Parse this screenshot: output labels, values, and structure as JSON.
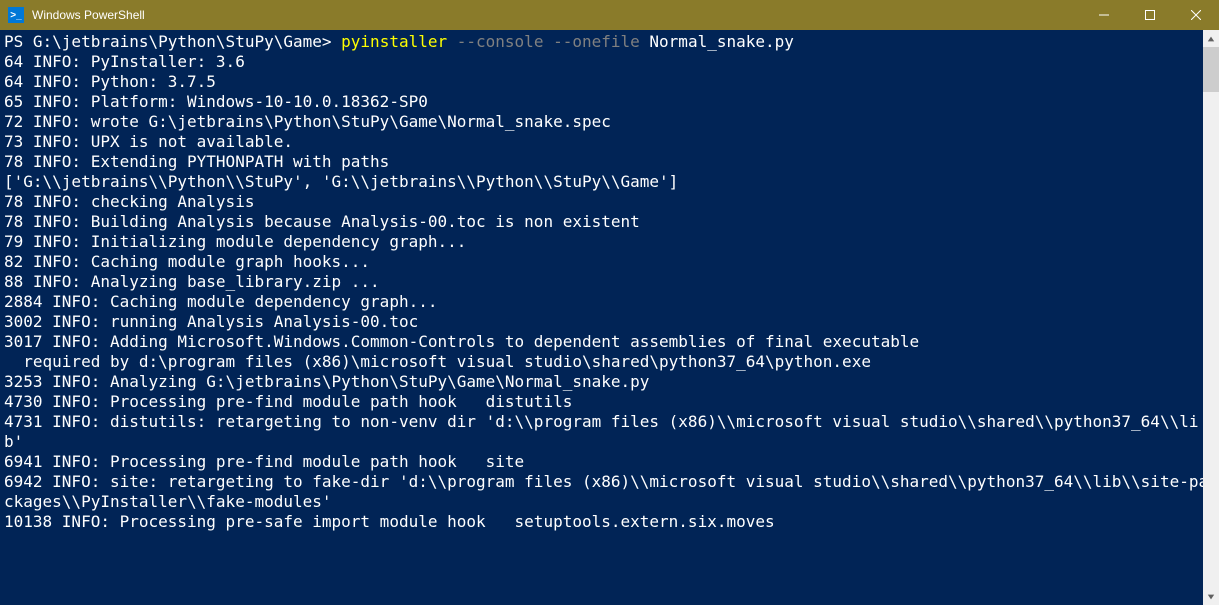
{
  "window": {
    "title": "Windows PowerShell"
  },
  "prompt": {
    "ps_path": "PS G:\\jetbrains\\Python\\StuPy\\Game> ",
    "cmd_name": "pyinstaller ",
    "cmd_flags": "--console --onefile ",
    "cmd_arg": "Normal_snake.py"
  },
  "lines": [
    "64 INFO: PyInstaller: 3.6",
    "64 INFO: Python: 3.7.5",
    "65 INFO: Platform: Windows-10-10.0.18362-SP0",
    "72 INFO: wrote G:\\jetbrains\\Python\\StuPy\\Game\\Normal_snake.spec",
    "73 INFO: UPX is not available.",
    "78 INFO: Extending PYTHONPATH with paths",
    "['G:\\\\jetbrains\\\\Python\\\\StuPy', 'G:\\\\jetbrains\\\\Python\\\\StuPy\\\\Game']",
    "78 INFO: checking Analysis",
    "78 INFO: Building Analysis because Analysis-00.toc is non existent",
    "79 INFO: Initializing module dependency graph...",
    "82 INFO: Caching module graph hooks...",
    "88 INFO: Analyzing base_library.zip ...",
    "2884 INFO: Caching module dependency graph...",
    "3002 INFO: running Analysis Analysis-00.toc",
    "3017 INFO: Adding Microsoft.Windows.Common-Controls to dependent assemblies of final executable",
    "  required by d:\\program files (x86)\\microsoft visual studio\\shared\\python37_64\\python.exe",
    "3253 INFO: Analyzing G:\\jetbrains\\Python\\StuPy\\Game\\Normal_snake.py",
    "4730 INFO: Processing pre-find module path hook   distutils",
    "4731 INFO: distutils: retargeting to non-venv dir 'd:\\\\program files (x86)\\\\microsoft visual studio\\\\shared\\\\python37_64\\\\lib'",
    "6941 INFO: Processing pre-find module path hook   site",
    "6942 INFO: site: retargeting to fake-dir 'd:\\\\program files (x86)\\\\microsoft visual studio\\\\shared\\\\python37_64\\\\lib\\\\site-packages\\\\PyInstaller\\\\fake-modules'",
    "10138 INFO: Processing pre-safe import module hook   setuptools.extern.six.moves"
  ]
}
